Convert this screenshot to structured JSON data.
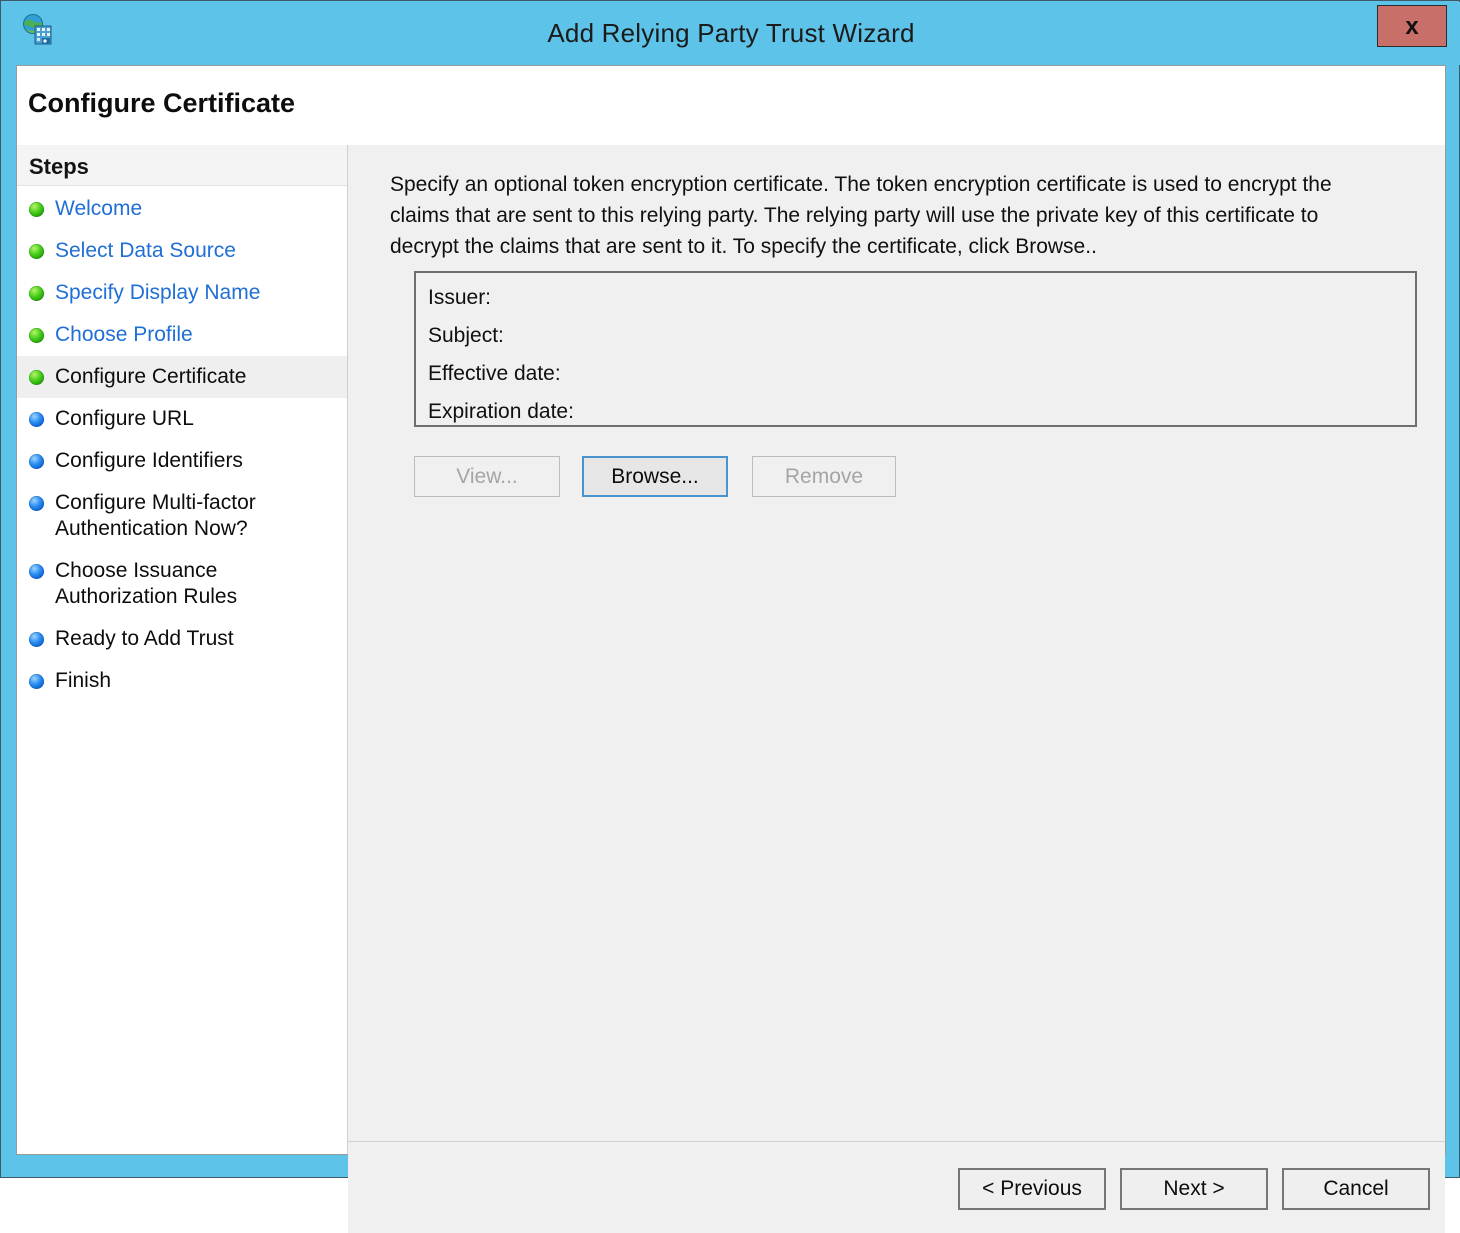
{
  "window": {
    "title": "Add Relying Party Trust Wizard",
    "icon": "globe-network-icon",
    "close_label": "x",
    "frame_color": "#5EC3E8",
    "close_color": "#c96f69"
  },
  "page": {
    "title": "Configure Certificate"
  },
  "sidebar": {
    "heading": "Steps",
    "items": [
      {
        "label": "Welcome",
        "state": "done",
        "bullet": "green"
      },
      {
        "label": "Select Data Source",
        "state": "done",
        "bullet": "green"
      },
      {
        "label": "Specify Display Name",
        "state": "done",
        "bullet": "green"
      },
      {
        "label": "Choose Profile",
        "state": "done",
        "bullet": "green"
      },
      {
        "label": "Configure Certificate",
        "state": "current",
        "bullet": "green"
      },
      {
        "label": "Configure URL",
        "state": "pending",
        "bullet": "blue"
      },
      {
        "label": "Configure Identifiers",
        "state": "pending",
        "bullet": "blue"
      },
      {
        "label": "Configure Multi-factor\nAuthentication Now?",
        "state": "pending",
        "bullet": "blue"
      },
      {
        "label": "Choose Issuance\nAuthorization Rules",
        "state": "pending",
        "bullet": "blue"
      },
      {
        "label": "Ready to Add Trust",
        "state": "pending",
        "bullet": "blue"
      },
      {
        "label": "Finish",
        "state": "pending",
        "bullet": "blue"
      }
    ]
  },
  "main": {
    "description": "Specify an optional token encryption certificate.  The token encryption certificate is used to encrypt the claims that are sent to this relying party.  The relying party will use the private key of this certificate to decrypt the claims that are sent to it.  To specify the certificate, click Browse..",
    "certificate": {
      "fields": [
        "Issuer:",
        "Subject:",
        "Effective date:",
        "Expiration date:"
      ]
    },
    "cert_buttons": {
      "view": "View...",
      "browse": "Browse...",
      "remove": "Remove"
    }
  },
  "footer": {
    "previous": "< Previous",
    "next": "Next >",
    "cancel": "Cancel"
  }
}
